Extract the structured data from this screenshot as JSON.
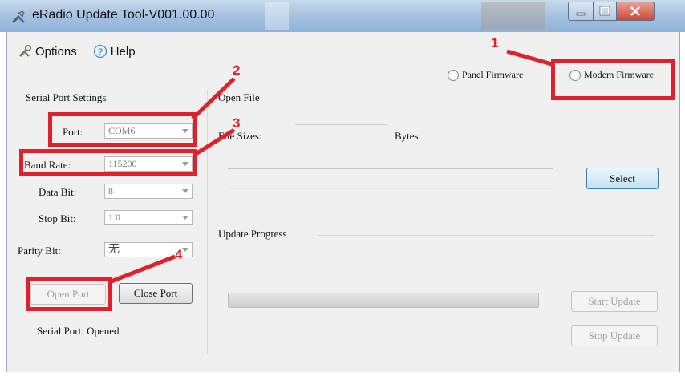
{
  "window": {
    "title": "eRadio Update Tool-V001.00.00"
  },
  "menu": {
    "options_label": "Options",
    "help_label": "Help"
  },
  "serial": {
    "section_label": "Serial Port Settings",
    "port_label": "Port:",
    "port_value": "COM6",
    "baud_label": "Baud Rate:",
    "baud_value": "115200",
    "databit_label": "Data Bit:",
    "databit_value": "8",
    "stopbit_label": "Stop Bit:",
    "stopbit_value": "1.0",
    "parity_label": "Parity Bit:",
    "parity_value": "无",
    "open_port_label": "Open Port",
    "close_port_label": "Close Port",
    "status_text": "Serial Port: Opened"
  },
  "firmware": {
    "panel_label": "Panel Firmware",
    "modem_label": "Modem Firmware"
  },
  "file": {
    "section_label": "Open File",
    "sizes_label": "File Sizes:",
    "bytes_label": "Bytes",
    "select_label": "Select"
  },
  "update": {
    "section_label": "Update Progress",
    "progress": 0,
    "start_label": "Start Update",
    "stop_label": "Stop Update"
  },
  "annotations": {
    "n1": "1",
    "n2": "2",
    "n3": "3",
    "n4": "4"
  },
  "colors": {
    "annotation": "#e0202a",
    "titlebar": "#a9c4e2"
  }
}
